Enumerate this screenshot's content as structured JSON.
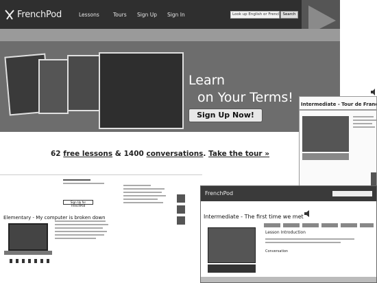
{
  "header": {
    "brand": "FrenchPod",
    "nav": [
      "Lessons",
      "Tours",
      "Sign Up",
      "Sign In"
    ],
    "search_placeholder": "Look up English or French...",
    "search_button": "Search"
  },
  "hero": {
    "title_line1": "Learn",
    "title_line2": "on Your Terms!",
    "cta": "Sign Up Now!",
    "tagline_prefix": "62",
    "tagline_link1": "free lessons",
    "tagline_mid": "&",
    "tagline_count": "1400",
    "tagline_link2": "conversations",
    "tagline_sep": ".",
    "tagline_link3": "Take the tour »"
  },
  "screenshot_right": {
    "title": "Intermediate - Tour de France"
  },
  "screenshot_left": {
    "signup": "Sign Up for FrenchPod",
    "lesson_title": "Elementary - My computer is broken down"
  },
  "screenshot_mid": {
    "brand": "FrenchPod",
    "lesson_title": "Intermediate - The first time we met",
    "intro_heading": "Lesson Introduction",
    "convo_label": "Conversation"
  }
}
